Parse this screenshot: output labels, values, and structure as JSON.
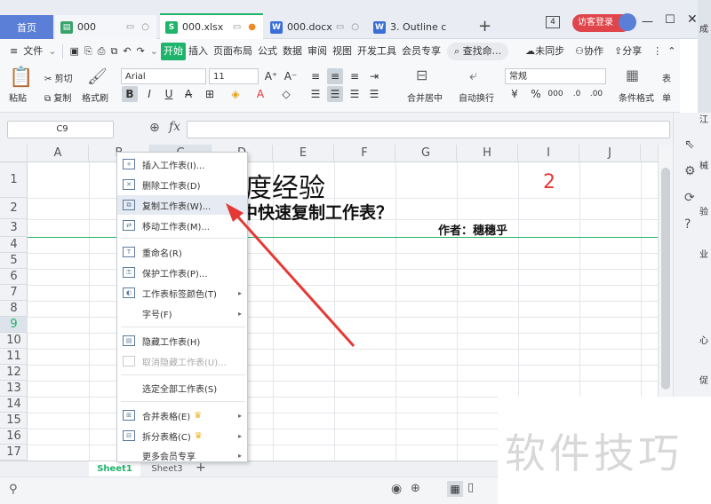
{
  "tabs": [
    {
      "label": "首页"
    },
    {
      "label": "000"
    },
    {
      "label": "000.xlsx"
    },
    {
      "label": "000.docx"
    },
    {
      "label": "3. Outline c"
    }
  ],
  "titlebar": {
    "badge": "4",
    "visitor_login": "访客登录",
    "new_tab": "+"
  },
  "menu": {
    "file": "文件",
    "items": [
      "开始",
      "插入",
      "页面布局",
      "公式",
      "数据",
      "审阅",
      "视图",
      "开发工具",
      "会员专享"
    ],
    "search": "查找命...",
    "unsynced": "未同步",
    "collab": "协作",
    "share": "分享"
  },
  "ribbon": {
    "cut": "剪切",
    "paste": "粘贴",
    "copy": "复制",
    "format_painter": "格式刷",
    "font_name": "Arial",
    "font_size": "11",
    "bold": "B",
    "italic": "I",
    "underline": "U",
    "merge_center": "合并居中",
    "wrap_text": "自动换行",
    "number_format": "常规",
    "cond_format": "条件格式",
    "table_style": "表",
    "format_short": "单"
  },
  "formula_bar": {
    "cell_ref": "C9",
    "fx": "fx",
    "value": ""
  },
  "grid": {
    "columns": [
      "A",
      "B",
      "C",
      "D",
      "E",
      "F",
      "G",
      "H",
      "I",
      "J"
    ],
    "rows": [
      "1",
      "2",
      "3",
      "4",
      "5",
      "6",
      "7",
      "8",
      "9",
      "10",
      "11",
      "12",
      "13",
      "14",
      "15",
      "16",
      "17"
    ],
    "cells": {
      "title": "度经验",
      "page_number": "2",
      "question": "中快速复制工作表？",
      "author": "作者：穗穗乎"
    }
  },
  "context_menu": {
    "items": [
      {
        "label": "插入工作表(I)...",
        "icon": "insert-sheet-icon"
      },
      {
        "label": "删除工作表(D)",
        "icon": "delete-sheet-icon"
      },
      {
        "label": "复制工作表(W)...",
        "icon": "copy-sheet-icon",
        "highlighted": true
      },
      {
        "label": "移动工作表(M)...",
        "icon": "move-sheet-icon"
      },
      {
        "label": "重命名(R)",
        "icon": "rename-icon"
      },
      {
        "label": "保护工作表(P)...",
        "icon": "protect-sheet-icon"
      },
      {
        "label": "工作表标签颜色(T)",
        "icon": "tab-color-icon",
        "submenu": true
      },
      {
        "label": "字号(F)",
        "icon": "",
        "submenu": true
      },
      {
        "label": "隐藏工作表(H)",
        "icon": "hide-sheet-icon"
      },
      {
        "label": "取消隐藏工作表(U)...",
        "icon": "unhide-sheet-icon",
        "disabled": true
      },
      {
        "label": "选定全部工作表(S)",
        "icon": ""
      },
      {
        "label": "合并表格(E)",
        "icon": "merge-table-icon",
        "crown": true,
        "submenu": true
      },
      {
        "label": "拆分表格(C)",
        "icon": "split-table-icon",
        "crown": true,
        "submenu": true
      },
      {
        "label": "更多会员专享",
        "icon": "",
        "submenu": true
      }
    ]
  },
  "sheets": [
    "Sheet1",
    "Sheet3"
  ],
  "sheet_add": "+",
  "watermark": "软件技巧",
  "side_fragments": [
    "成",
    "江",
    "械",
    "验",
    "心",
    "业",
    "促"
  ],
  "colors": {
    "accent_green": "#1fb46b",
    "home_tab": "#5b7fd6",
    "login_red": "#e0454b",
    "arrow_red": "#e53935",
    "page_num_red": "#e53935"
  }
}
